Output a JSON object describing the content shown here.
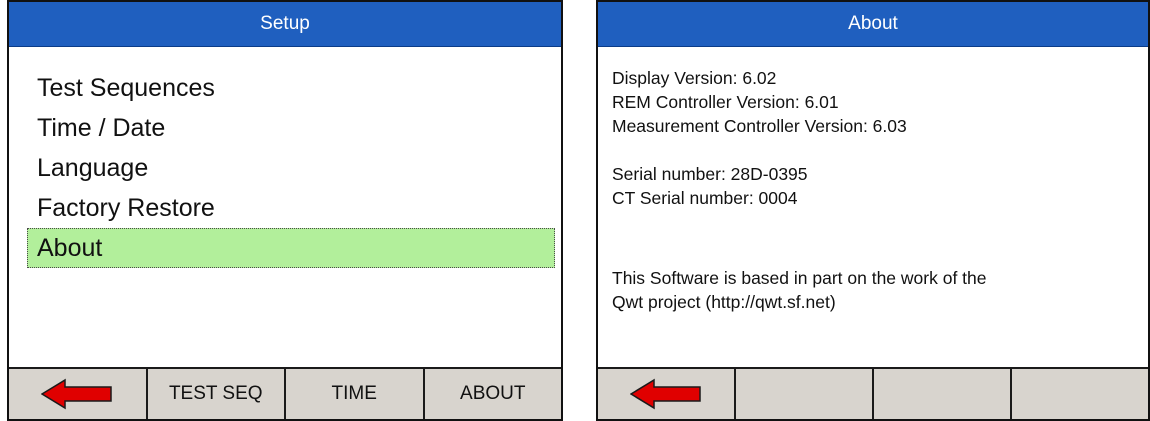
{
  "setup": {
    "title": "Setup",
    "menu": [
      {
        "label": "Test Sequences",
        "selected": false
      },
      {
        "label": "Time / Date",
        "selected": false
      },
      {
        "label": "Language",
        "selected": false
      },
      {
        "label": "Factory Restore",
        "selected": false
      },
      {
        "label": "About",
        "selected": true
      }
    ],
    "softkeys": [
      {
        "icon": "back-arrow-icon",
        "label": ""
      },
      {
        "label": "TEST SEQ"
      },
      {
        "label": "TIME"
      },
      {
        "label": "ABOUT"
      }
    ]
  },
  "about": {
    "title": "About",
    "lines": {
      "display_version": "Display Version: 6.02",
      "rem_controller_version": "REM Controller Version: 6.01",
      "measurement_controller_version": "Measurement Controller Version: 6.03",
      "serial_number": "Serial number: 28D-0395",
      "ct_serial_number": "CT Serial number: 0004",
      "credits_line1": "This Software is based in part on the work of the",
      "credits_line2": "Qwt project (http://qwt.sf.net)"
    },
    "softkeys": [
      {
        "icon": "back-arrow-icon",
        "label": ""
      },
      {
        "label": ""
      },
      {
        "label": ""
      },
      {
        "label": ""
      }
    ]
  },
  "colors": {
    "title_bar": "#1f5fbf",
    "selection_highlight": "#b2ef9b",
    "softkey_bar": "#d8d4ce",
    "back_arrow": "#e00000"
  }
}
